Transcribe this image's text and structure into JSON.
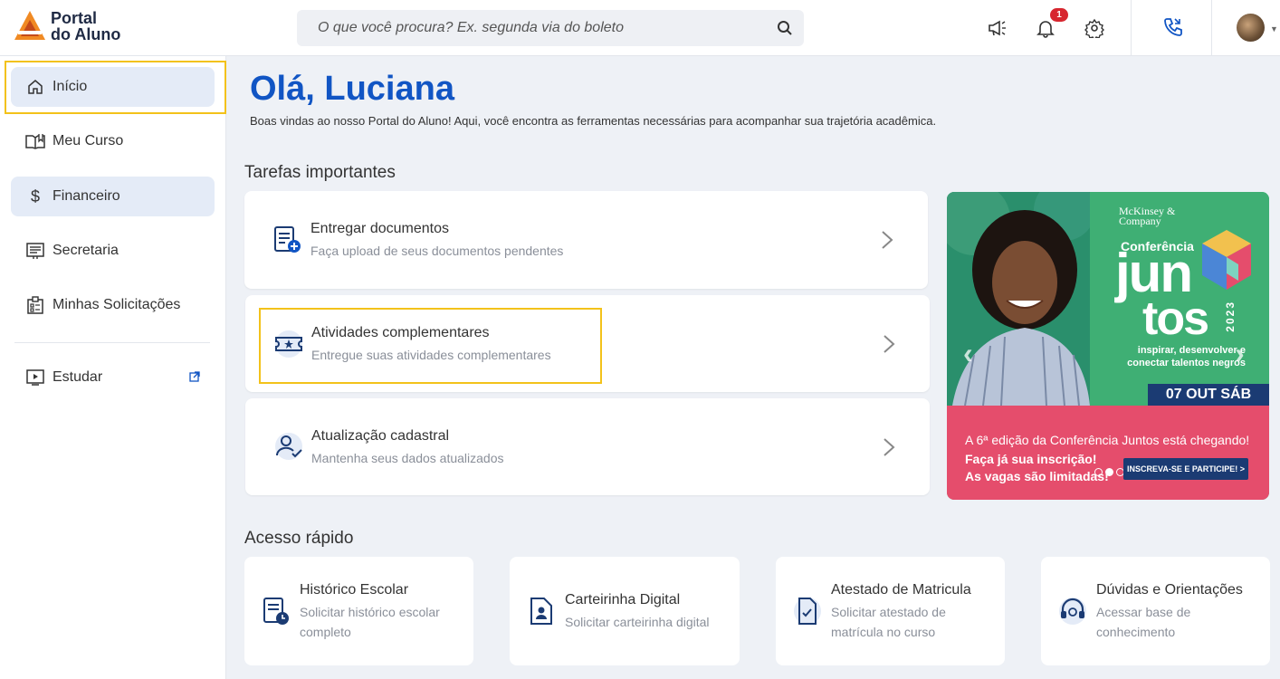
{
  "header": {
    "logo_line1": "Portal",
    "logo_line2": "do Aluno",
    "search_placeholder": "O que você procura? Ex. segunda via do boleto",
    "notification_count": "1",
    "icons": [
      "megaphone-icon",
      "bell-icon",
      "gear-icon",
      "phone-icon",
      "avatar"
    ]
  },
  "sidebar": {
    "items": [
      {
        "label": "Início",
        "icon": "home-icon",
        "active": true
      },
      {
        "label": "Meu Curso",
        "icon": "book-icon"
      },
      {
        "label": "Financeiro",
        "icon": "dollar-icon",
        "active": true
      },
      {
        "label": "Secretaria",
        "icon": "list-icon"
      },
      {
        "label": "Minhas Solicitações",
        "icon": "clipboard-icon"
      },
      {
        "label": "Estudar",
        "icon": "play-icon",
        "external": true
      }
    ]
  },
  "main": {
    "greeting": "Olá, Luciana",
    "welcome": "Boas vindas ao nosso Portal do Aluno! Aqui, você encontra as ferramentas necessárias para acompanhar sua trajetória acadêmica.",
    "tasks_title": "Tarefas importantes",
    "tasks": [
      {
        "title": "Entregar documentos",
        "subtitle": "Faça upload de seus documentos pendentes"
      },
      {
        "title": "Atividades complementares",
        "subtitle": "Entregue suas atividades complementares"
      },
      {
        "title": "Atualização cadastral",
        "subtitle": "Mantenha seus dados atualizados"
      }
    ],
    "quick_title": "Acesso rápido",
    "quick": [
      {
        "title": "Histórico Escolar",
        "subtitle": "Solicitar histórico escolar completo"
      },
      {
        "title": "Carteirinha Digital",
        "subtitle": "Solicitar carteirinha digital"
      },
      {
        "title": "Atestado de Matricula",
        "subtitle": "Solicitar atestado de matrícula no curso"
      },
      {
        "title": "Dúvidas e Orientações",
        "subtitle": "Acessar base de conhecimento"
      }
    ]
  },
  "banner": {
    "brand": "McKinsey & Company",
    "conf": "Conferência",
    "word1": "jun",
    "word2": "tos",
    "year": "2023",
    "tagline": "inspirar, desenvolver e conectar talentos negros",
    "date": "07 OUT SÁB",
    "line1": "A 6ª edição da Conferência Juntos está chegando!",
    "line2": "Faça já sua inscrição!",
    "line3": "As vagas são limitadas!",
    "cta": "INSCREVA-SE E PARTICIPE! >",
    "colors": {
      "green": "#3faf74",
      "pink": "#e54d6c",
      "navy": "#1b3b73"
    }
  },
  "colors": {
    "accent": "#1155c4",
    "highlight": "#f3c21a",
    "badge": "#d7262f"
  }
}
